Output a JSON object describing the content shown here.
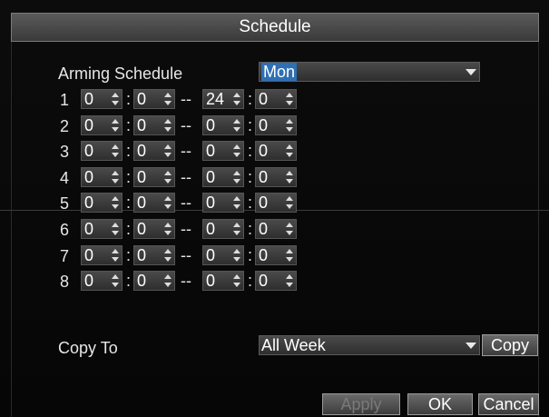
{
  "window": {
    "title": "Schedule"
  },
  "arming": {
    "label": "Arming Schedule",
    "day": "Mon"
  },
  "rows": [
    {
      "num": "1",
      "start_h": "0",
      "start_m": "0",
      "end_h": "24",
      "end_m": "0"
    },
    {
      "num": "2",
      "start_h": "0",
      "start_m": "0",
      "end_h": "0",
      "end_m": "0"
    },
    {
      "num": "3",
      "start_h": "0",
      "start_m": "0",
      "end_h": "0",
      "end_m": "0"
    },
    {
      "num": "4",
      "start_h": "0",
      "start_m": "0",
      "end_h": "0",
      "end_m": "0"
    },
    {
      "num": "5",
      "start_h": "0",
      "start_m": "0",
      "end_h": "0",
      "end_m": "0"
    },
    {
      "num": "6",
      "start_h": "0",
      "start_m": "0",
      "end_h": "0",
      "end_m": "0"
    },
    {
      "num": "7",
      "start_h": "0",
      "start_m": "0",
      "end_h": "0",
      "end_m": "0"
    },
    {
      "num": "8",
      "start_h": "0",
      "start_m": "0",
      "end_h": "0",
      "end_m": "0"
    }
  ],
  "separators": {
    "colon": ":",
    "dash": "--"
  },
  "copy": {
    "label": "Copy To",
    "target": "All Week",
    "button": "Copy"
  },
  "footer": {
    "apply": "Apply",
    "ok": "OK",
    "cancel": "Cancel"
  },
  "colors": {
    "highlight": "#2f6fb3",
    "disabled_text": "#7a7a7a"
  }
}
